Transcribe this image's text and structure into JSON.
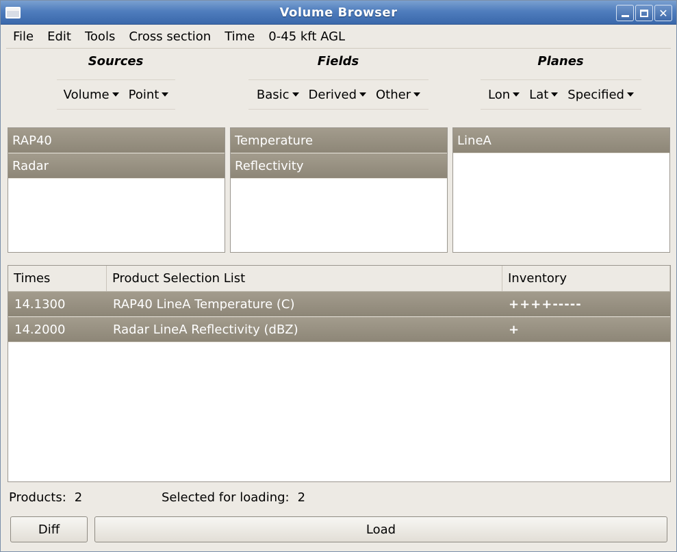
{
  "window": {
    "title": "Volume Browser",
    "controls": [
      "minimize",
      "maximize",
      "close"
    ]
  },
  "menu": [
    "File",
    "Edit",
    "Tools",
    "Cross section",
    "Time",
    "0-45 kft AGL"
  ],
  "sources": {
    "header": "Sources",
    "dropdowns": [
      "Volume",
      "Point"
    ],
    "items": [
      "RAP40",
      "Radar"
    ]
  },
  "fields": {
    "header": "Fields",
    "dropdowns": [
      "Basic",
      "Derived",
      "Other"
    ],
    "items": [
      "Temperature",
      "Reflectivity"
    ]
  },
  "planes": {
    "header": "Planes",
    "dropdowns": [
      "Lon",
      "Lat",
      "Specified"
    ],
    "items": [
      "LineA"
    ]
  },
  "table": {
    "columns": [
      "Times",
      "Product Selection List",
      "Inventory"
    ],
    "rows": [
      {
        "time": "14.1300",
        "product": "RAP40 LineA Temperature (C)",
        "inventory": "++++-----"
      },
      {
        "time": "14.2000",
        "product": "Radar LineA Reflectivity (dBZ)",
        "inventory": "+"
      }
    ]
  },
  "status": {
    "products_label": "Products:",
    "products_value": "2",
    "selected_label": "Selected for loading:",
    "selected_value": "2"
  },
  "buttons": {
    "diff": "Diff",
    "load": "Load"
  },
  "colors": {
    "titlebar": "#4f7dbd",
    "selected_row": "#968f80",
    "window_bg": "#edeae4"
  }
}
